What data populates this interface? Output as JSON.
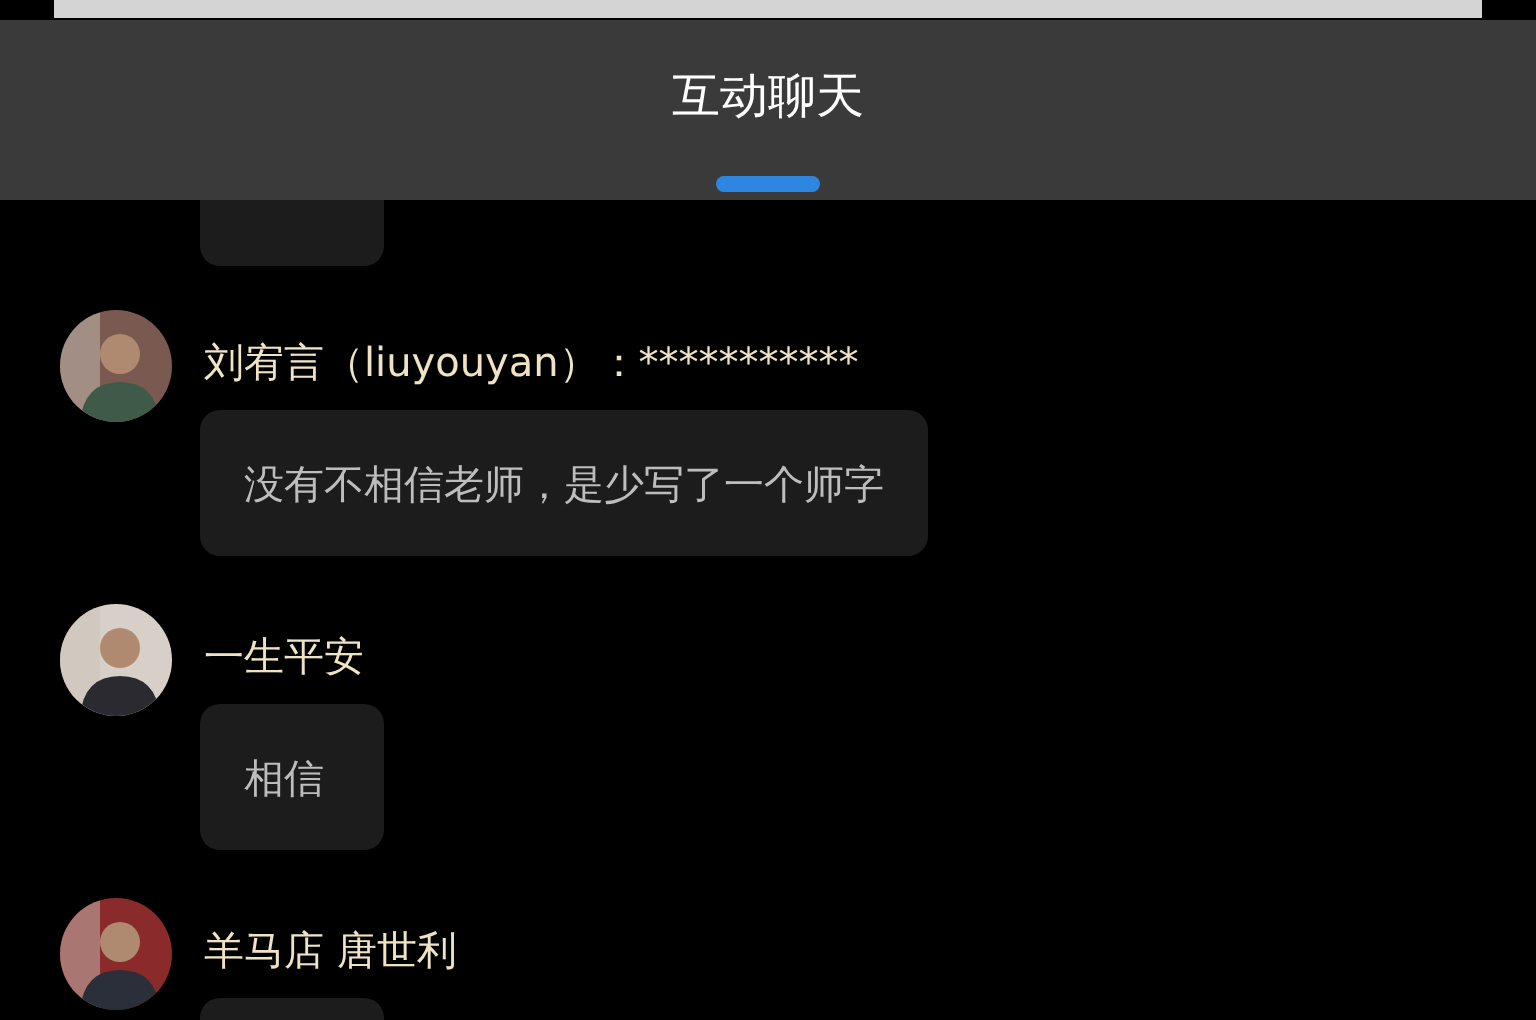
{
  "header": {
    "title": "互动聊天"
  },
  "messages": [
    {
      "kind": "cut_top"
    },
    {
      "kind": "message",
      "name": "刘宥言（liuyouyan）：***********",
      "text": "没有不相信老师，是少写了一个师字"
    },
    {
      "kind": "message",
      "name": "一生平安",
      "text": "相信"
    },
    {
      "kind": "message",
      "name": "羊马店 唐世利"
    }
  ]
}
